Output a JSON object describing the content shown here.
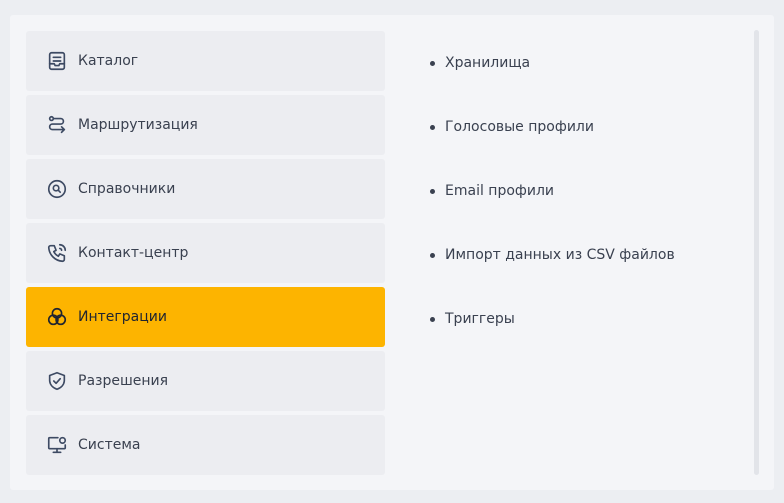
{
  "menu": {
    "items": [
      {
        "label": "Каталог",
        "icon": "catalog-icon"
      },
      {
        "label": "Маршрутизация",
        "icon": "routing-icon"
      },
      {
        "label": "Справочники",
        "icon": "search-circle-icon"
      },
      {
        "label": "Контакт-центр",
        "icon": "phone-call-icon"
      },
      {
        "label": "Интеграции",
        "icon": "integrations-icon",
        "active": true
      },
      {
        "label": "Разрешения",
        "icon": "shield-check-icon"
      },
      {
        "label": "Система",
        "icon": "monitor-settings-icon"
      }
    ]
  },
  "submenu": {
    "items": [
      {
        "label": "Хранилища"
      },
      {
        "label": "Голосовые профили"
      },
      {
        "label": "Email профили"
      },
      {
        "label": "Импорт данных из CSV файлов"
      },
      {
        "label": "Триггеры"
      }
    ]
  },
  "colors": {
    "active": "#fdb400",
    "item_bg": "#ecedf1",
    "panel_bg": "#f4f5f8",
    "page_bg": "#eceef2",
    "icon": "#3d4a63"
  }
}
